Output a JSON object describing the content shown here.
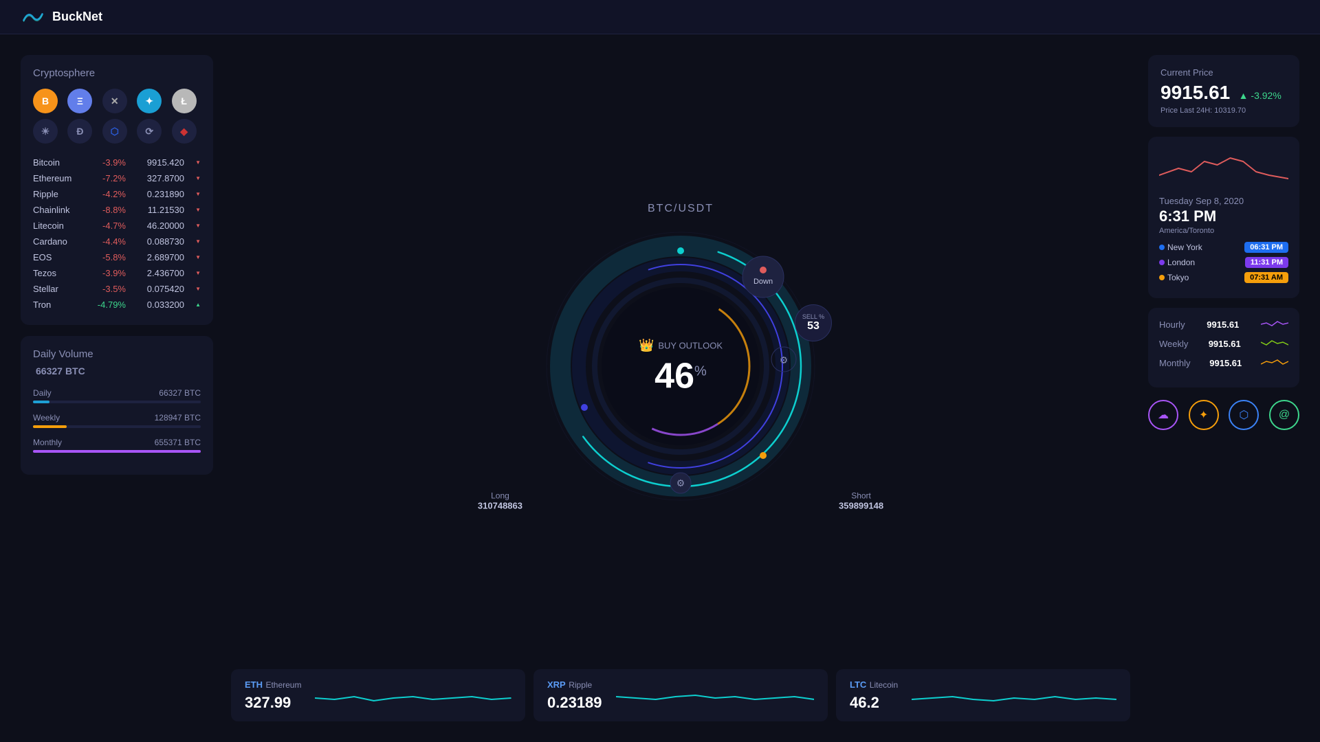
{
  "app": {
    "name": "BuckNet"
  },
  "header": {
    "logo_text": "BuckNet"
  },
  "cryptosphere": {
    "title": "Cryptosphere",
    "icons": [
      {
        "id": "btc",
        "label": "B",
        "bg": "#f7931a",
        "text": "#fff"
      },
      {
        "id": "eth",
        "label": "Ξ",
        "bg": "#627eea",
        "text": "#fff"
      },
      {
        "id": "xmr",
        "label": "✕",
        "bg": "#1e2240",
        "text": "#aaa"
      },
      {
        "id": "xlm",
        "label": "✦",
        "bg": "#1a9fd4",
        "text": "#fff"
      },
      {
        "id": "ltc",
        "label": "Ł",
        "bg": "#b8b8b8",
        "text": "#fff"
      },
      {
        "id": "sun",
        "label": "☀",
        "bg": "#1e2240",
        "text": "#8a8fb5"
      },
      {
        "id": "doge",
        "label": "Ð",
        "bg": "#1e2240",
        "text": "#8a8fb5"
      },
      {
        "id": "link",
        "label": "⬡",
        "bg": "#1e2240",
        "text": "#2a5bd7"
      },
      {
        "id": "atom",
        "label": "⟳",
        "bg": "#1e2240",
        "text": "#8a8fb5"
      },
      {
        "id": "ada",
        "label": "◆",
        "bg": "#1e2240",
        "text": "#cc3333"
      }
    ],
    "coins": [
      {
        "name": "Bitcoin",
        "change": "-3.9%",
        "price": "9915.420",
        "up": false
      },
      {
        "name": "Ethereum",
        "change": "-7.2%",
        "price": "327.8700",
        "up": false
      },
      {
        "name": "Ripple",
        "change": "-4.2%",
        "price": "0.231890",
        "up": false
      },
      {
        "name": "Chainlink",
        "change": "-8.8%",
        "price": "11.21530",
        "up": false
      },
      {
        "name": "Litecoin",
        "change": "-4.7%",
        "price": "46.20000",
        "up": false
      },
      {
        "name": "Cardano",
        "change": "-4.4%",
        "price": "0.088730",
        "up": false
      },
      {
        "name": "EOS",
        "change": "-5.8%",
        "price": "2.689700",
        "up": false
      },
      {
        "name": "Tezos",
        "change": "-3.9%",
        "price": "2.436700",
        "up": false
      },
      {
        "name": "Stellar",
        "change": "-3.5%",
        "price": "0.075420",
        "up": false
      },
      {
        "name": "Tron",
        "change": "-4.79%",
        "price": "0.033200",
        "up": true
      }
    ]
  },
  "daily_volume": {
    "title": "Daily Volume",
    "amount": "66327",
    "unit": "BTC",
    "rows": [
      {
        "label": "Daily",
        "value": "66327 BTC",
        "bar_pct": 10,
        "color": "#1e9fd4"
      },
      {
        "label": "Weekly",
        "value": "128947 BTC",
        "bar_pct": 20,
        "color": "#f59e0b"
      },
      {
        "label": "Monthly",
        "value": "655371 BTC",
        "bar_pct": 100,
        "color": "#a855f7"
      }
    ]
  },
  "gauge": {
    "pair": "BTC/USDT",
    "label": "BUY OUTLOOK",
    "value": "46",
    "percent_sign": "%",
    "long_label": "Long",
    "long_value": "310748863",
    "short_label": "Short",
    "short_value": "359899148",
    "down_label": "Down",
    "sell_label": "SELL %",
    "sell_value": "53"
  },
  "tickers": [
    {
      "symbol": "ETH",
      "name": "Ethereum",
      "price": "327.99"
    },
    {
      "symbol": "XRP",
      "name": "Ripple",
      "price": "0.23189"
    },
    {
      "symbol": "LTC",
      "name": "Litecoin",
      "price": "46.2"
    }
  ],
  "current_price": {
    "label": "Current Price",
    "price": "9915.61",
    "change": "-3.92%",
    "last_24h_label": "Price Last 24H:",
    "last_24h_value": "10319.70"
  },
  "clock": {
    "date": "Tuesday Sep 8, 2020",
    "time": "6:31 PM",
    "timezone": "America/Toronto",
    "cities": [
      {
        "name": "New York",
        "time": "06:31 PM",
        "badge": "badge-blue",
        "dot": "#1e6ef0"
      },
      {
        "name": "London",
        "time": "11:31 PM",
        "badge": "badge-purple",
        "dot": "#7c3aed"
      },
      {
        "name": "Tokyo",
        "time": "07:31 AM",
        "badge": "badge-orange",
        "dot": "#f59e0b"
      }
    ]
  },
  "price_stats": {
    "rows": [
      {
        "label": "Hourly",
        "value": "9915.61",
        "color": "#a855f7"
      },
      {
        "label": "Weekly",
        "value": "9915.61",
        "color": "#84cc16"
      },
      {
        "label": "Monthly",
        "value": "9915.61",
        "color": "#f59e0b"
      }
    ]
  },
  "bottom_icons": [
    {
      "id": "cloud",
      "symbol": "☁",
      "color": "#a855f7"
    },
    {
      "id": "star",
      "symbol": "✦",
      "color": "#f59e0b"
    },
    {
      "id": "chip",
      "symbol": "⬡",
      "color": "#3b82f6"
    },
    {
      "id": "at",
      "symbol": "@",
      "color": "#3dd68c"
    }
  ]
}
